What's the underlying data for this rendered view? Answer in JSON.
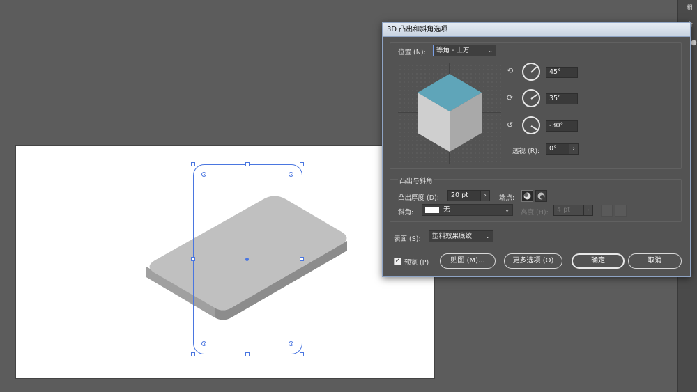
{
  "dialog": {
    "title": "3D 凸出和斜角选项",
    "position_label": "位置 (N):",
    "position_value": "等角 - 上方",
    "rotation_x": "45°",
    "rotation_y": "35°",
    "rotation_z": "-30°",
    "perspective_label": "透视 (R):",
    "perspective_value": "0°",
    "extrude_group_label": "凸出与斜角",
    "extrude_depth_label": "凸出厚度 (D):",
    "extrude_depth_value": "20 pt",
    "cap_label": "端点:",
    "bevel_label": "斜角:",
    "bevel_value": "无",
    "height_label": "高度 (H):",
    "height_value": "4 pt",
    "surface_label": "表面 (S):",
    "surface_value": "塑料效果底纹",
    "preview_label": "预览 (P)",
    "map_button": "贴图 (M)...",
    "more_options_button": "更多选项 (O)",
    "ok_button": "确定",
    "cancel_button": "取消"
  },
  "right_panel": {
    "label_top": "粗",
    "label_mid": "合"
  },
  "colors": {
    "dialog_bg": "#535353",
    "canvas_bg": "#5c5c5c",
    "selection": "#4a76e0",
    "cube_top": "#5fa5b9",
    "shape_top": "#c0c0c0"
  }
}
